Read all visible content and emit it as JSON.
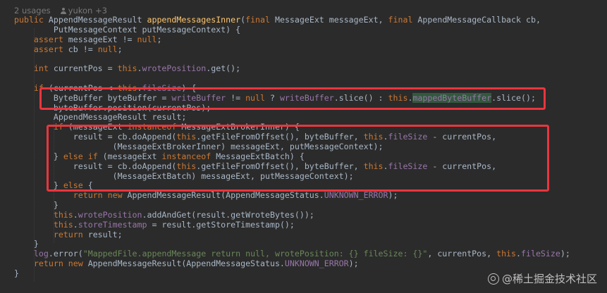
{
  "editor": {
    "usage_hint": {
      "usages": "2 usages",
      "author": "yukon +3"
    },
    "code_lines": [
      [
        {
          "t": "public ",
          "c": "k"
        },
        {
          "t": "AppendMessageResult "
        },
        {
          "t": "appendMessagesInner",
          "c": "m"
        },
        {
          "t": "("
        },
        {
          "t": "final ",
          "c": "k"
        },
        {
          "t": "MessageExt messageExt, "
        },
        {
          "t": "final ",
          "c": "k"
        },
        {
          "t": "AppendMessageCallback cb,"
        }
      ],
      [
        {
          "t": "        PutMessageContext putMessageContext) {"
        }
      ],
      [
        {
          "t": "    "
        },
        {
          "t": "assert ",
          "c": "k"
        },
        {
          "t": "messageExt != "
        },
        {
          "t": "null",
          "c": "k"
        },
        {
          "t": ";"
        }
      ],
      [
        {
          "t": "    "
        },
        {
          "t": "assert ",
          "c": "k"
        },
        {
          "t": "cb != "
        },
        {
          "t": "null",
          "c": "k"
        },
        {
          "t": ";"
        }
      ],
      [
        {
          "t": ""
        }
      ],
      [
        {
          "t": "    "
        },
        {
          "t": "int ",
          "c": "k"
        },
        {
          "t": "currentPos = "
        },
        {
          "t": "this",
          "c": "k"
        },
        {
          "t": "."
        },
        {
          "t": "wrotePosition",
          "c": "f"
        },
        {
          "t": ".get();"
        }
      ],
      [
        {
          "t": ""
        }
      ],
      [
        {
          "t": "    "
        },
        {
          "t": "if ",
          "c": "k"
        },
        {
          "t": "(currentPos < "
        },
        {
          "t": "this",
          "c": "k"
        },
        {
          "t": "."
        },
        {
          "t": "fileSize",
          "c": "f"
        },
        {
          "t": ") {"
        }
      ],
      [
        {
          "t": "        ByteBuffer byteBuffer = "
        },
        {
          "t": "writeBuffer",
          "c": "f"
        },
        {
          "t": " != "
        },
        {
          "t": "null ",
          "c": "k"
        },
        {
          "t": "? "
        },
        {
          "t": "writeBuffer",
          "c": "f"
        },
        {
          "t": ".slice() : "
        },
        {
          "t": "this",
          "c": "k"
        },
        {
          "t": "."
        },
        {
          "t": "mappedByteBuffer",
          "c": "hl"
        },
        {
          "t": ".slice();"
        }
      ],
      [
        {
          "t": "        byteBuffer.position(currentPos);"
        }
      ],
      [
        {
          "t": "        AppendMessageResult result;"
        }
      ],
      [
        {
          "t": "        "
        },
        {
          "t": "if ",
          "c": "k"
        },
        {
          "t": "(messageExt "
        },
        {
          "t": "instanceof ",
          "c": "k"
        },
        {
          "t": "MessageExtBrokerInner) {"
        }
      ],
      [
        {
          "t": "            result = cb.doAppend("
        },
        {
          "t": "this",
          "c": "k"
        },
        {
          "t": ".getFileFromOffset(), byteBuffer, "
        },
        {
          "t": "this",
          "c": "k"
        },
        {
          "t": "."
        },
        {
          "t": "fileSize",
          "c": "f"
        },
        {
          "t": " - currentPos,"
        }
      ],
      [
        {
          "t": "                    (MessageExtBrokerInner) messageExt, putMessageContext);"
        }
      ],
      [
        {
          "t": "        } "
        },
        {
          "t": "else if ",
          "c": "k"
        },
        {
          "t": "(messageExt "
        },
        {
          "t": "instanceof ",
          "c": "k"
        },
        {
          "t": "MessageExtBatch) {"
        }
      ],
      [
        {
          "t": "            result = cb.doAppend("
        },
        {
          "t": "this",
          "c": "k"
        },
        {
          "t": ".getFileFromOffset(), byteBuffer, "
        },
        {
          "t": "this",
          "c": "k"
        },
        {
          "t": "."
        },
        {
          "t": "fileSize",
          "c": "f"
        },
        {
          "t": " - currentPos,"
        }
      ],
      [
        {
          "t": "                    (MessageExtBatch) messageExt, putMessageContext);"
        }
      ],
      [
        {
          "t": "        } "
        },
        {
          "t": "else ",
          "c": "k"
        },
        {
          "t": "{"
        }
      ],
      [
        {
          "t": "            "
        },
        {
          "t": "return new ",
          "c": "k"
        },
        {
          "t": "AppendMessageResult(AppendMessageStatus."
        },
        {
          "t": "UNKNOWN_ERROR",
          "c": "f"
        },
        {
          "t": ");"
        }
      ],
      [
        {
          "t": "        }"
        }
      ],
      [
        {
          "t": "        "
        },
        {
          "t": "this",
          "c": "k"
        },
        {
          "t": "."
        },
        {
          "t": "wrotePosition",
          "c": "f"
        },
        {
          "t": ".addAndGet(result.getWroteBytes());"
        }
      ],
      [
        {
          "t": "        "
        },
        {
          "t": "this",
          "c": "k"
        },
        {
          "t": "."
        },
        {
          "t": "storeTimestamp",
          "c": "f"
        },
        {
          "t": " = result.getStoreTimestamp();"
        }
      ],
      [
        {
          "t": "        "
        },
        {
          "t": "return ",
          "c": "k"
        },
        {
          "t": "result;"
        }
      ],
      [
        {
          "t": "    }"
        }
      ],
      [
        {
          "t": "    "
        },
        {
          "t": "log",
          "c": "f"
        },
        {
          "t": ".error("
        },
        {
          "t": "\"MappedFile.appendMessage return null, wrotePosition: {} fileSize: {}\"",
          "c": "s"
        },
        {
          "t": ", currentPos, "
        },
        {
          "t": "this",
          "c": "k"
        },
        {
          "t": "."
        },
        {
          "t": "fileSize",
          "c": "f"
        },
        {
          "t": ");"
        }
      ],
      [
        {
          "t": "    "
        },
        {
          "t": "return new ",
          "c": "k"
        },
        {
          "t": "AppendMessageResult(AppendMessageStatus."
        },
        {
          "t": "UNKNOWN_ERROR",
          "c": "f"
        },
        {
          "t": ");"
        }
      ],
      [
        {
          "t": "}"
        }
      ]
    ]
  },
  "colors": {
    "background": "#2b2b2b",
    "keyword": "#cc7832",
    "default_text": "#a9b7c6",
    "field": "#9876aa",
    "method": "#ffc66d",
    "string": "#6a8759",
    "highlight_bg": "#32593d",
    "annotation_box": "#e8363d"
  },
  "watermark": {
    "text": "@稀土掘金技术社区"
  }
}
